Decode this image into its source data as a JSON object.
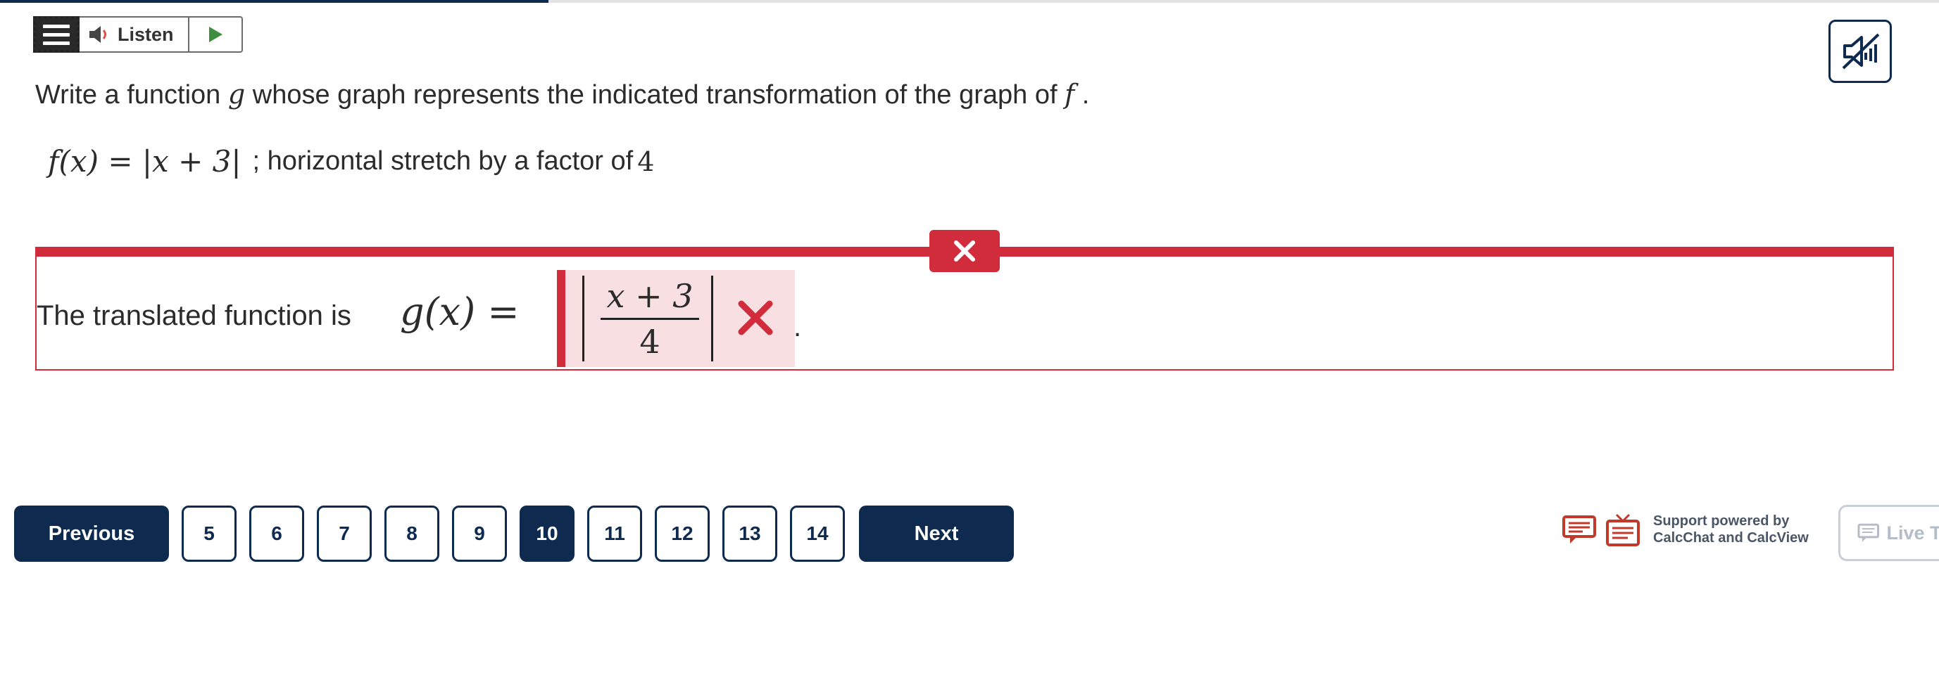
{
  "progress": {
    "fraction": 0.283
  },
  "toolbar": {
    "listen_label": "Listen"
  },
  "question": {
    "prompt_before": "Write a function ",
    "prompt_var_g": "g",
    "prompt_middle": " whose graph represents the indicated transformation of the graph of ",
    "prompt_var_f": "f",
    "prompt_end": " .",
    "given_math": "f(x) = |x + 3|",
    "given_text": "; horizontal stretch by a factor of ",
    "given_factor": "4"
  },
  "answer": {
    "label": "The translated function is",
    "lhs": "g(x) =",
    "numerator": "x + 3",
    "denominator": "4",
    "status": "incorrect",
    "trailing": "."
  },
  "navigation": {
    "previous_label": "Previous",
    "next_label": "Next",
    "pages": [
      "5",
      "6",
      "7",
      "8",
      "9",
      "10",
      "11",
      "12",
      "13",
      "14"
    ],
    "current_page": "10"
  },
  "support": {
    "line1": "Support powered by",
    "line2": "CalcChat and CalcView",
    "live_label": "Live Tutor"
  },
  "colors": {
    "navy": "#0f2a4f",
    "error_red": "#d12c3c",
    "error_fill": "#f8dfe1",
    "support_red": "#c0392b"
  }
}
